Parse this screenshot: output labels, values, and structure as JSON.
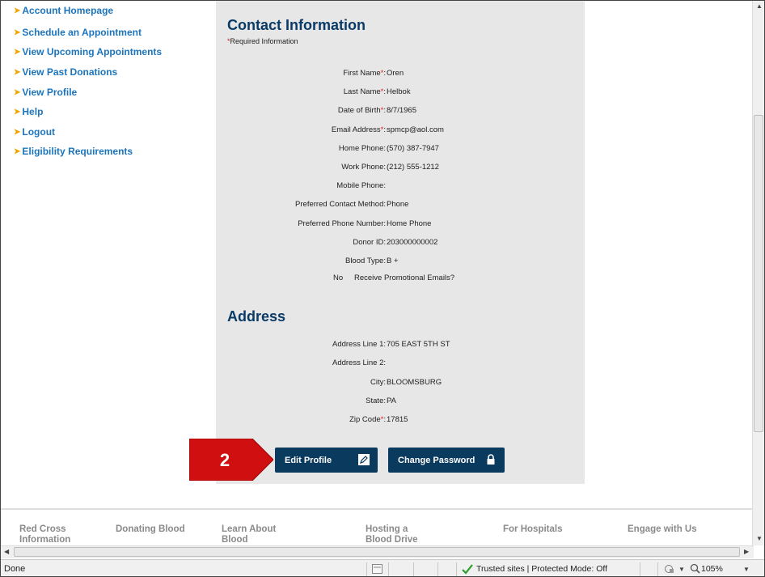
{
  "nav": {
    "items": [
      {
        "label": "Account Homepage"
      },
      {
        "label": "Schedule an Appointment"
      },
      {
        "label": "View Upcoming Appointments"
      },
      {
        "label": "View Past Donations"
      },
      {
        "label": "View Profile"
      },
      {
        "label": "Help"
      },
      {
        "label": "Logout"
      },
      {
        "label": "Eligibility Requirements"
      }
    ]
  },
  "contact": {
    "title": "Contact Information",
    "required_asterisk": "*",
    "required_note": "Required Information",
    "fields": [
      {
        "label": "First Name",
        "required": true,
        "value": "Oren"
      },
      {
        "label": "Last Name",
        "required": true,
        "value": "Helbok"
      },
      {
        "label": "Date of Birth",
        "required": true,
        "value": "8/7/1965"
      },
      {
        "label": "Email Address",
        "required": true,
        "value": "spmcp@aol.com"
      },
      {
        "label": "Home Phone",
        "required": false,
        "value": "(570) 387-7947"
      },
      {
        "label": "Work Phone",
        "required": false,
        "value": "(212) 555-1212"
      },
      {
        "label": "Mobile Phone",
        "required": false,
        "value": ""
      },
      {
        "label": "Preferred Contact Method",
        "required": false,
        "value": "Phone"
      },
      {
        "label": "Preferred Phone Number",
        "required": false,
        "value": "Home Phone"
      },
      {
        "label": "Donor ID",
        "required": false,
        "value": "203000000002"
      },
      {
        "label": "Blood Type",
        "required": false,
        "value": "B +"
      }
    ],
    "promo": {
      "value": "No",
      "label": "Receive Promotional Emails?"
    }
  },
  "address": {
    "title": "Address",
    "fields": [
      {
        "label": "Address Line 1",
        "required": false,
        "value": "705 EAST 5TH ST"
      },
      {
        "label": "Address Line 2",
        "required": false,
        "value": ""
      },
      {
        "label": "City",
        "required": false,
        "value": "BLOOMSBURG"
      },
      {
        "label": "State",
        "required": false,
        "value": "PA"
      },
      {
        "label": "Zip Code",
        "required": true,
        "value": "17815"
      }
    ]
  },
  "buttons": {
    "edit_profile": "Edit Profile",
    "change_password": "Change Password"
  },
  "callout": {
    "number": "2",
    "color": "#d01010"
  },
  "footer": {
    "links": [
      "Red Cross\nInformation",
      "Donating Blood",
      "Learn About\nBlood",
      "Hosting a\nBlood Drive",
      "For Hospitals",
      "Engage with Us"
    ]
  },
  "status_bar": {
    "left": "Done",
    "zone": "Trusted sites | Protected Mode: Off",
    "zoom": "105%"
  },
  "colors": {
    "nav_link": "#1c75bc",
    "heading": "#0a3a66",
    "button": "#0a3a5e",
    "panel": "#e7e7e7"
  }
}
